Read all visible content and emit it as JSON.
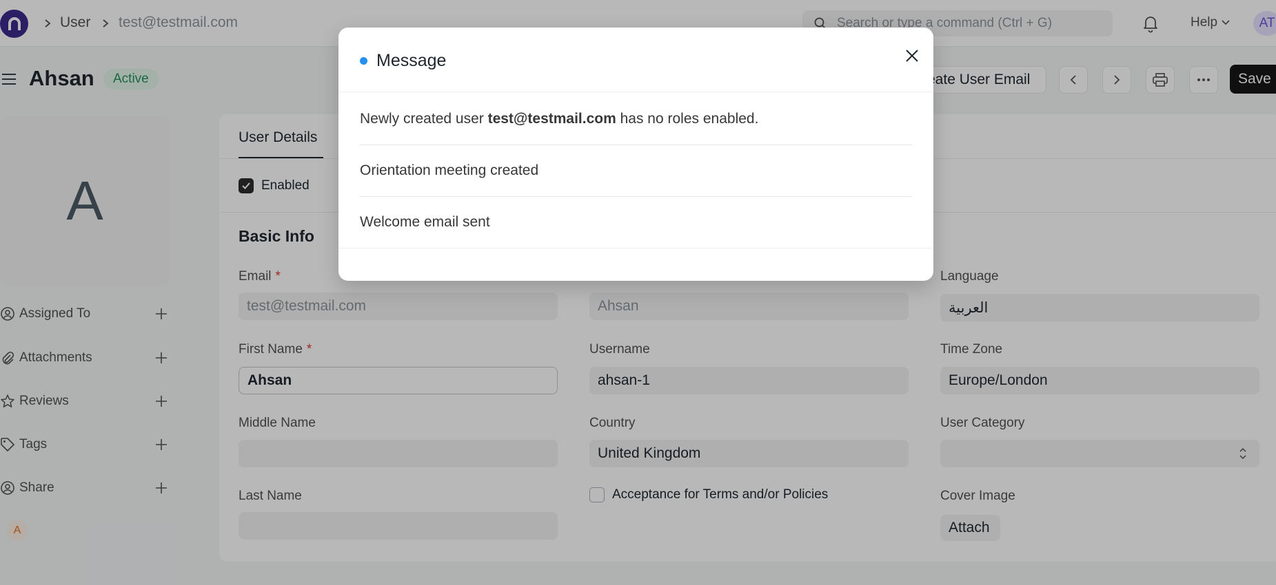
{
  "breadcrumb": {
    "doctype": "User",
    "record": "test@testmail.com"
  },
  "search": {
    "placeholder": "Search or type a command (Ctrl + G)"
  },
  "navbar": {
    "help_label": "Help",
    "avatar_initials": "AT"
  },
  "header": {
    "title": "Ahsan",
    "status": "Active",
    "create_email_label": "eate User Email",
    "save_label": "Save"
  },
  "sidebar": {
    "avatar_letter": "A",
    "items": [
      {
        "label": "Assigned To",
        "icon": "assign-icon"
      },
      {
        "label": "Attachments",
        "icon": "paperclip-icon"
      },
      {
        "label": "Reviews",
        "icon": "star-icon"
      },
      {
        "label": "Tags",
        "icon": "tag-icon"
      },
      {
        "label": "Share",
        "icon": "share-icon"
      }
    ],
    "viewer_initial": "A"
  },
  "form": {
    "tab_label": "User Details",
    "enabled_label": "Enabled",
    "section_title": "Basic Info",
    "email": {
      "label": "Email",
      "required": "*",
      "value": "test@testmail.com"
    },
    "full_name": {
      "value": "Ahsan"
    },
    "language": {
      "label": "Language",
      "value": "العربية"
    },
    "first_name": {
      "label": "First Name",
      "required": "*",
      "value": "Ahsan"
    },
    "username": {
      "label": "Username",
      "value": "ahsan-1"
    },
    "time_zone": {
      "label": "Time Zone",
      "value": "Europe/London"
    },
    "middle_name": {
      "label": "Middle Name",
      "value": ""
    },
    "country": {
      "label": "Country",
      "value": "United Kingdom"
    },
    "user_category": {
      "label": "User Category",
      "value": ""
    },
    "last_name": {
      "label": "Last Name",
      "value": ""
    },
    "terms_label": "Acceptance for Terms and/or Policies",
    "cover_image": {
      "label": "Cover Image",
      "button": "Attach"
    }
  },
  "modal": {
    "title": "Message",
    "messages": [
      {
        "prefix": "Newly created user ",
        "bold": "test@testmail.com",
        "suffix": " has no roles enabled."
      },
      {
        "text": "Orientation meeting created"
      },
      {
        "text": "Welcome email sent"
      }
    ]
  },
  "colors": {
    "brand": "#3d2a8c",
    "indicator": "#2490ef",
    "status_green": "#278f5e",
    "save_bg": "#171717"
  }
}
